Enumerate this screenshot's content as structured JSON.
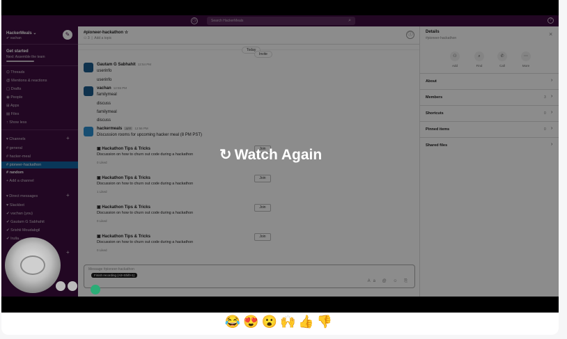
{
  "topbar": {
    "history_icon": "clock-icon",
    "search_placeholder": "Search HackerMeals",
    "search_icon": "⌕",
    "help_icon": "?"
  },
  "sidebar": {
    "workspace": "HackerMeals ⌄",
    "user": "✔ vachan",
    "compose_icon": "✎",
    "get_started": "Get started",
    "get_started_sub": "Next: Assemble the team",
    "items": [
      "Threads",
      "Mentions & reactions",
      "Drafts",
      "People",
      "Apps",
      "Files",
      "Show less"
    ],
    "item_icons": [
      "⌬",
      "@",
      "▢",
      "◉",
      "⊞",
      "▤",
      "↑"
    ],
    "channels_header": "▾ Channels",
    "channels": [
      "# general",
      "# hacker-meal",
      "# pioneer-hackathon",
      "# random",
      "+ Add a channel"
    ],
    "dm_header": "▾ Direct messages",
    "dms": [
      "♥ Slackbot",
      "✔ vachan  (you)",
      "✔ Gautam G Sabhahit",
      "✔ Srishti Moudabgil",
      "✔ Irulla..."
    ]
  },
  "channel": {
    "name": "#pioneer-hackathon",
    "star_icon": "☆",
    "members": "⚇ 3",
    "topic": "Add a topic",
    "info_icon": "ⓘ",
    "date_pill": "Today",
    "invite_label": "Invite"
  },
  "messages": [
    {
      "author": "Gautam G Sabhahit",
      "time": "12:54 PM",
      "text": "userinfo"
    },
    {
      "text": "userinfo"
    },
    {
      "author": "vachan",
      "time": "12:55 PM",
      "text": "familymeal"
    },
    {
      "text": "discuss"
    },
    {
      "text": "familymeal"
    },
    {
      "text": "discuss"
    },
    {
      "author": "hackermeals",
      "app_badge": "APP",
      "time": "12:56 PM",
      "text": "Discussion rooms for upcoming hacker meal (8 PM PST)"
    }
  ],
  "events": [
    {
      "title": "Hackathon Tips & Tricks",
      "desc": "Discussion on how to churn out code during a hackathon",
      "likes": "0 Liked",
      "join": "Join"
    },
    {
      "title": "Hackathon Tips & Tricks",
      "desc": "Discussion on how to churn out code during a hackathon",
      "likes": "1 Liked",
      "join": "Join"
    },
    {
      "title": "Hackathon Tips & Tricks",
      "desc": "Discussion on how to churn out code during a hackathon",
      "likes": "0 Liked",
      "join": "Join"
    },
    {
      "title": "Hackathon Tips & Tricks",
      "desc": "Discussion on how to churn out code during a hackathon",
      "likes": "0 Liked",
      "join": "Join"
    }
  ],
  "composer": {
    "placeholder": "Message #pioneer-hackathon",
    "tooltip": "Finish recording (Alt+Shift+1)",
    "tools": "Aa @ ☺ ⎘"
  },
  "details": {
    "title": "Details",
    "subtitle": "#pioneer-hackathon",
    "close": "×",
    "actions": [
      {
        "label": "Add",
        "icon": "⚇"
      },
      {
        "label": "Find",
        "icon": "⌕"
      },
      {
        "label": "Call",
        "icon": "✆"
      },
      {
        "label": "More",
        "icon": "⋯"
      }
    ],
    "sections": [
      {
        "label": "About",
        "count": ""
      },
      {
        "label": "Members",
        "count": "3"
      },
      {
        "label": "Shortcuts",
        "count": "0"
      },
      {
        "label": "Pinned items",
        "count": "0"
      },
      {
        "label": "Shared files",
        "count": ""
      }
    ],
    "chevron": "›"
  },
  "player": {
    "watch_again": "Watch Again",
    "replay_icon": "↻"
  },
  "reactions": [
    "😂",
    "😍",
    "😮",
    "🙌",
    "👍",
    "👎"
  ],
  "colors": {
    "aubergine": "#3f0e40",
    "selected_channel": "#1164a3",
    "overlay": "rgba(0,0,0,0.45)"
  }
}
